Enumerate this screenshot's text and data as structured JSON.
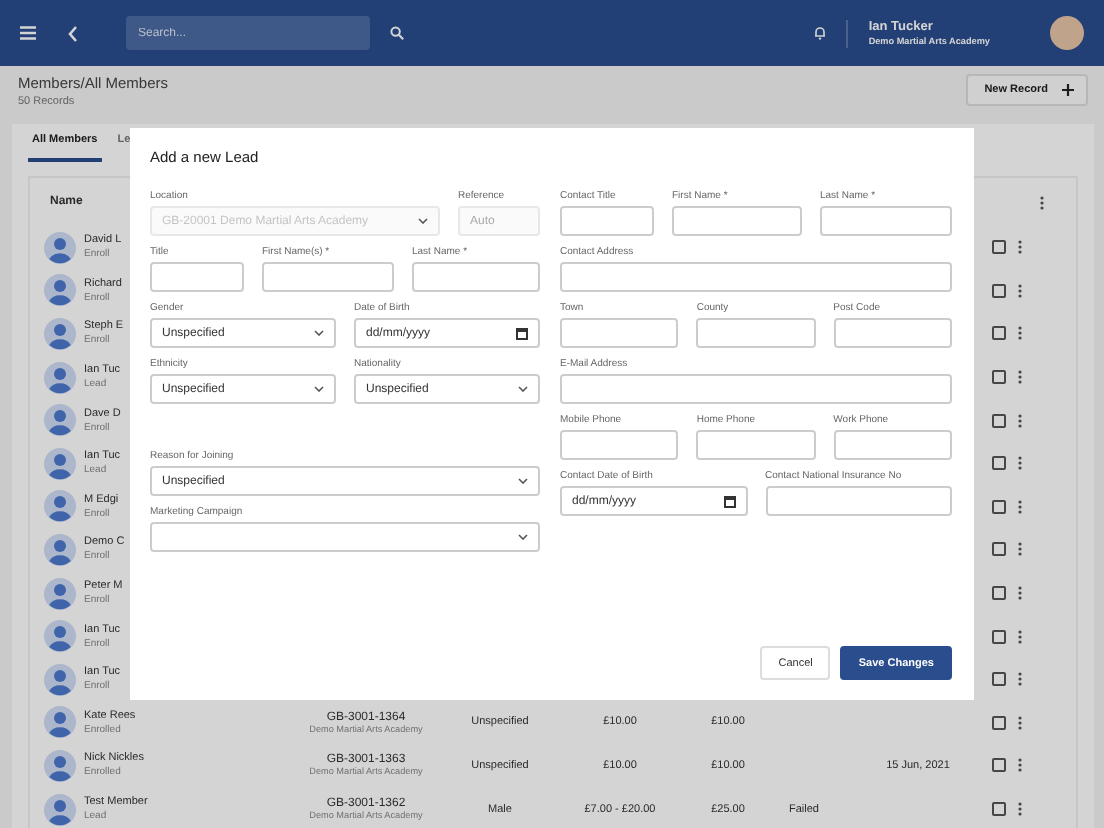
{
  "header": {
    "search_placeholder": "Search...",
    "user_name": "Ian Tucker",
    "user_org": "Demo Martial Arts Academy"
  },
  "page": {
    "title": "Members/All Members",
    "subtitle": "50 Records",
    "new_button": "New Record"
  },
  "tabs": [
    {
      "label": "All Members",
      "selected": true
    },
    {
      "label": "Le",
      "selected": false
    }
  ],
  "table": {
    "columns": [
      "Name"
    ],
    "rows": [
      {
        "name": "David L",
        "status": "Enroll",
        "checked": false
      },
      {
        "name": "Richard",
        "status": "Enroll",
        "checked": false
      },
      {
        "name": "Steph E",
        "status": "Enroll",
        "checked": false
      },
      {
        "name": "Ian Tuc",
        "status": "Lead",
        "checked": false
      },
      {
        "name": "Dave D",
        "status": "Enroll",
        "checked": false
      },
      {
        "name": "Ian Tuc",
        "status": "Lead",
        "checked": false
      },
      {
        "name": "M Edgi",
        "status": "Enroll",
        "checked": false
      },
      {
        "name": "Demo C",
        "status": "Enroll",
        "checked": false
      },
      {
        "name": "Peter M",
        "status": "Enroll",
        "checked": false
      },
      {
        "name": "Ian Tuc",
        "status": "Enroll",
        "checked": false
      },
      {
        "name": "Ian Tuc",
        "status": "Enroll",
        "checked": false
      },
      {
        "name": "Kate Rees",
        "status": "Enrolled",
        "member_id": "GB-3001-1364",
        "location": "Demo Martial Arts Academy",
        "gender": "Unspecified",
        "fee": "£10.00",
        "paid": "£10.00",
        "checked": false
      },
      {
        "name": "Nick Nickles",
        "status": "Enrolled",
        "member_id": "GB-3001-1363",
        "location": "Demo Martial Arts Academy",
        "gender": "Unspecified",
        "fee": "£10.00",
        "paid": "£10.00",
        "date": "15 Jun, 2021",
        "checked": false
      },
      {
        "name": "Test Member",
        "status": "Lead",
        "member_id": "GB-3001-1362",
        "location": "Demo Martial Arts Academy",
        "gender": "Male",
        "fee": "£7.00 - £20.00",
        "paid": "£25.00",
        "payment_status": "Failed",
        "checked": false
      }
    ]
  },
  "dialog": {
    "title": "Add a new Lead",
    "left_rows": [
      [
        {
          "label": "Location",
          "kind": "select",
          "value": "GB-20001 Demo Martial Arts Academy",
          "disabled": true
        },
        {
          "label": "Reference",
          "kind": "text",
          "placeholder": "Auto",
          "disabled": true
        }
      ],
      [
        {
          "label": "Title",
          "kind": "text",
          "disabled": false
        },
        {
          "label": "First Name(s) *",
          "kind": "text",
          "disabled": false
        },
        {
          "label": "Last Name *",
          "kind": "text",
          "disabled": false
        }
      ],
      [
        {
          "label": "Gender",
          "kind": "select",
          "value": "Unspecified",
          "disabled": false
        },
        {
          "label": "Date of Birth",
          "kind": "date",
          "placeholder": "dd/mm/yyyy",
          "disabled": false
        }
      ],
      [
        {
          "label": "Ethnicity",
          "kind": "select",
          "value": "Unspecified",
          "disabled": false
        },
        {
          "label": "Nationality",
          "kind": "select",
          "value": "Unspecified",
          "disabled": false
        }
      ],
      [
        {
          "label": "Reason for Joining",
          "kind": "select",
          "value": "Unspecified",
          "disabled": false
        }
      ],
      [
        {
          "label": "Marketing Campaign",
          "kind": "select",
          "disabled": false
        }
      ]
    ],
    "right_rows": [
      [
        {
          "label": "Contact Title",
          "kind": "text",
          "disabled": false
        },
        {
          "label": "First Name *",
          "kind": "text",
          "disabled": false
        },
        {
          "label": "Last Name *",
          "kind": "text",
          "disabled": false
        }
      ],
      [
        {
          "label": "Contact Address",
          "kind": "text",
          "disabled": false
        }
      ],
      [
        {
          "label": "Town",
          "kind": "text",
          "disabled": false
        },
        {
          "label": "County",
          "kind": "text",
          "disabled": false
        },
        {
          "label": "Post Code",
          "kind": "text",
          "disabled": false
        }
      ],
      [
        {
          "label": "E-Mail Address",
          "kind": "text",
          "disabled": false
        }
      ],
      [
        {
          "label": "Mobile Phone",
          "kind": "text",
          "disabled": false
        },
        {
          "label": "Home Phone",
          "kind": "text",
          "disabled": false
        },
        {
          "label": "Work Phone",
          "kind": "text",
          "disabled": false
        }
      ],
      [
        {
          "label": "Contact Date of Birth",
          "kind": "date",
          "placeholder": "dd/mm/yyyy",
          "disabled": false
        },
        {
          "label": "Contact National Insurance No",
          "kind": "text",
          "disabled": false
        }
      ]
    ],
    "buttons": [
      {
        "label": "Cancel",
        "kind": "secondary"
      },
      {
        "label": "Save Changes",
        "kind": "primary"
      }
    ]
  }
}
